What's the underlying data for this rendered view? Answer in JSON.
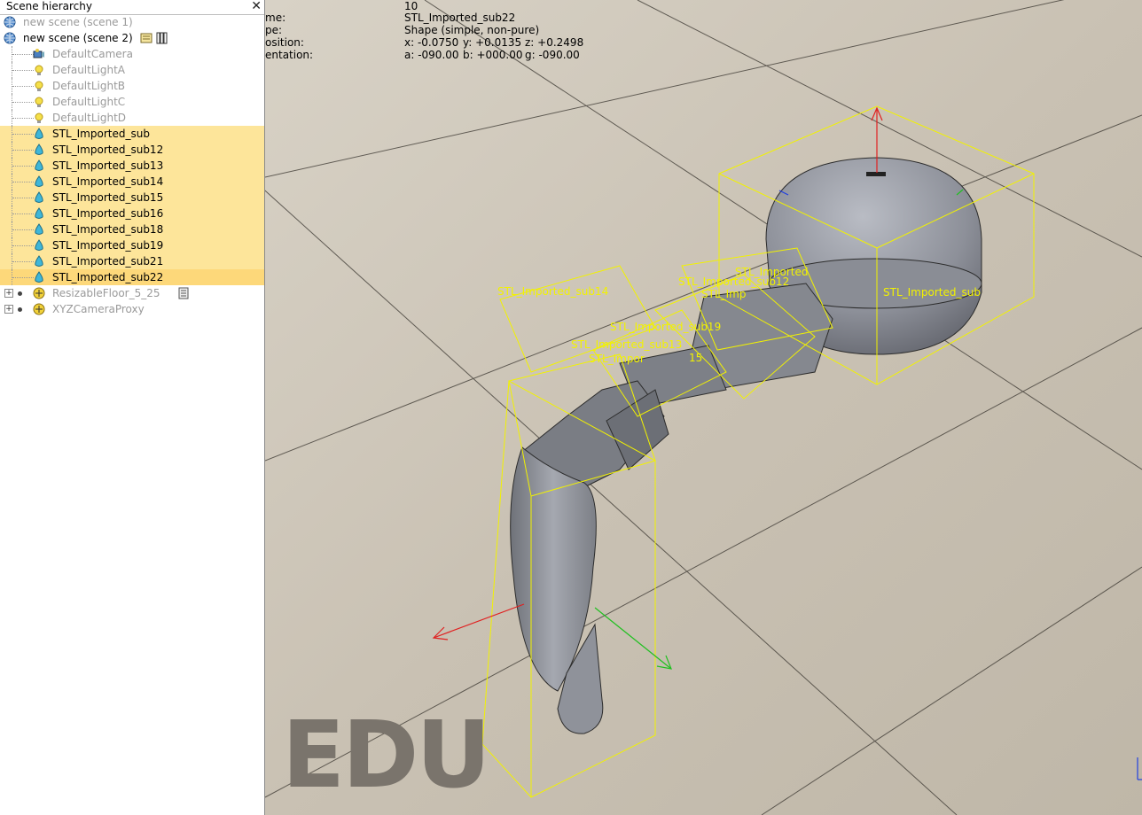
{
  "panel": {
    "title": "Scene hierarchy",
    "close": "✕",
    "items": [
      {
        "label": "new scene (scene 1)",
        "kind": "scene",
        "dim": true
      },
      {
        "label": "new scene (scene 2)",
        "kind": "scene",
        "dim": false
      },
      {
        "label": "DefaultCamera",
        "kind": "camera",
        "dim": true
      },
      {
        "label": "DefaultLightA",
        "kind": "light",
        "dim": true
      },
      {
        "label": "DefaultLightB",
        "kind": "light",
        "dim": true
      },
      {
        "label": "DefaultLightC",
        "kind": "light",
        "dim": true
      },
      {
        "label": "DefaultLightD",
        "kind": "light",
        "dim": true
      },
      {
        "label": "STL_Imported_sub",
        "kind": "shape",
        "selected": true
      },
      {
        "label": "STL_Imported_sub12",
        "kind": "shape",
        "selected": true
      },
      {
        "label": "STL_Imported_sub13",
        "kind": "shape",
        "selected": true
      },
      {
        "label": "STL_Imported_sub14",
        "kind": "shape",
        "selected": true
      },
      {
        "label": "STL_Imported_sub15",
        "kind": "shape",
        "selected": true
      },
      {
        "label": "STL_Imported_sub16",
        "kind": "shape",
        "selected": true
      },
      {
        "label": "STL_Imported_sub18",
        "kind": "shape",
        "selected": true
      },
      {
        "label": "STL_Imported_sub19",
        "kind": "shape",
        "selected": true
      },
      {
        "label": "STL_Imported_sub21",
        "kind": "shape",
        "selected": true
      },
      {
        "label": "STL_Imported_sub22",
        "kind": "shape",
        "selected": true,
        "current": true
      },
      {
        "label": "ResizableFloor_5_25",
        "kind": "floor",
        "dim": true
      },
      {
        "label": "XYZCameraProxy",
        "kind": "proxy",
        "dim": true
      }
    ]
  },
  "info": {
    "row1_label": "",
    "row1_value": "10",
    "row2_label": "me:",
    "row2_value": "STL_Imported_sub22",
    "row3_label": "pe:",
    "row3_value": "Shape (simple, non-pure)",
    "row4_label": "osition:",
    "row4_x": "x: -0.0750",
    "row4_y": "y: +0.0135",
    "row4_z": "z: +0.2498",
    "row5_label": "entation:",
    "row5_a": "a: -090.00",
    "row5_b": "b: +000.00",
    "row5_g": "g: -090.00"
  },
  "viewport_labels": [
    "STL_Imported_sub14",
    "STL_Imported_sub12",
    "STL_Imported",
    "STL_Imp",
    "STL_Imported_sub",
    "STL_Imported_sub19",
    "STL_Imported_sub13",
    "STL_Impor",
    "15"
  ],
  "watermark": "EDU",
  "colors": {
    "selection": "#fde59a",
    "bbox": "#f2f200",
    "axis_x": "#e02020",
    "axis_y": "#20c020",
    "axis_z": "#2040e0"
  }
}
